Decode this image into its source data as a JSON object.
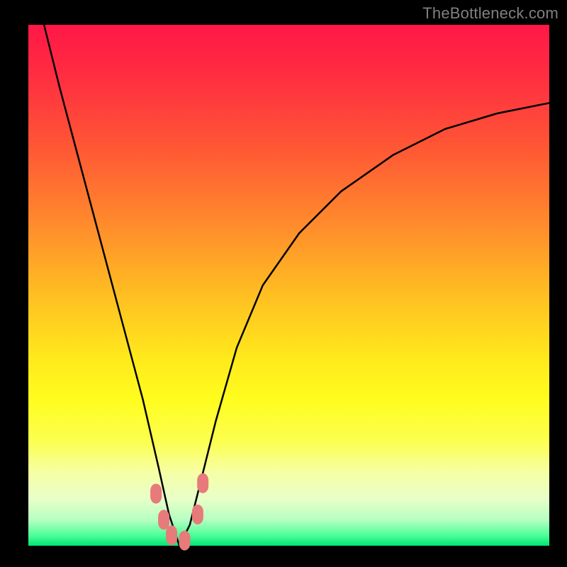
{
  "watermark": "TheBottleneck.com",
  "chart_data": {
    "type": "line",
    "title": "",
    "xlabel": "",
    "ylabel": "",
    "xlim": [
      0,
      100
    ],
    "ylim": [
      0,
      100
    ],
    "grid": false,
    "legend": false,
    "notes": "Bottleneck-style V-curve over rainbow gradient. Minimum sits near x≈29, y≈0. No numeric axes are shown in the image; values are positional estimates on a 0–100 canvas.",
    "series": [
      {
        "name": "curve",
        "color": "#000000",
        "x": [
          3,
          6,
          10,
          14,
          18,
          22,
          25,
          27,
          29,
          31,
          33,
          36,
          40,
          45,
          52,
          60,
          70,
          80,
          90,
          100
        ],
        "y": [
          100,
          88,
          73,
          58,
          43,
          28,
          15,
          6,
          0,
          4,
          12,
          24,
          38,
          50,
          60,
          68,
          75,
          80,
          83,
          85
        ]
      }
    ],
    "markers": [
      {
        "x": 24.5,
        "y": 10,
        "color": "#e77a7a"
      },
      {
        "x": 26.0,
        "y": 5,
        "color": "#e77a7a"
      },
      {
        "x": 27.5,
        "y": 2,
        "color": "#e77a7a"
      },
      {
        "x": 30.0,
        "y": 1,
        "color": "#e77a7a"
      },
      {
        "x": 32.5,
        "y": 6,
        "color": "#e77a7a"
      },
      {
        "x": 33.5,
        "y": 12,
        "color": "#e77a7a"
      }
    ],
    "gradient_stops": [
      {
        "pos": 0.0,
        "color": "#ff1847"
      },
      {
        "pos": 0.25,
        "color": "#ff6a30"
      },
      {
        "pos": 0.5,
        "color": "#ffd21f"
      },
      {
        "pos": 0.78,
        "color": "#fdff4a"
      },
      {
        "pos": 0.93,
        "color": "#d2ffc0"
      },
      {
        "pos": 1.0,
        "color": "#00e472"
      }
    ]
  }
}
